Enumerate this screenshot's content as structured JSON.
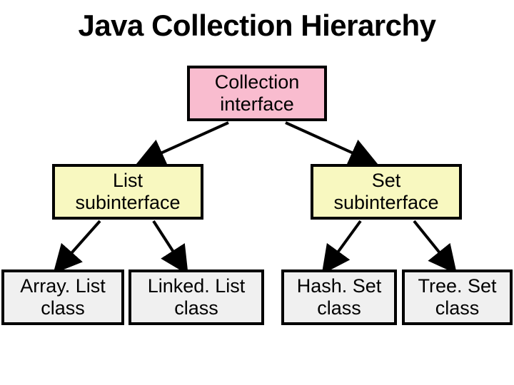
{
  "title": "Java Collection Hierarchy",
  "nodes": {
    "root": {
      "line1": "Collection",
      "line2": "interface"
    },
    "list": {
      "line1": "List",
      "line2": "subinterface"
    },
    "set": {
      "line1": "Set",
      "line2": "subinterface"
    },
    "arraylist": {
      "line1": "Array. List",
      "line2": "class"
    },
    "linkedlist": {
      "line1": "Linked. List",
      "line2": "class"
    },
    "hashset": {
      "line1": "Hash. Set",
      "line2": "class"
    },
    "treeset": {
      "line1": "Tree. Set",
      "line2": "class"
    }
  }
}
